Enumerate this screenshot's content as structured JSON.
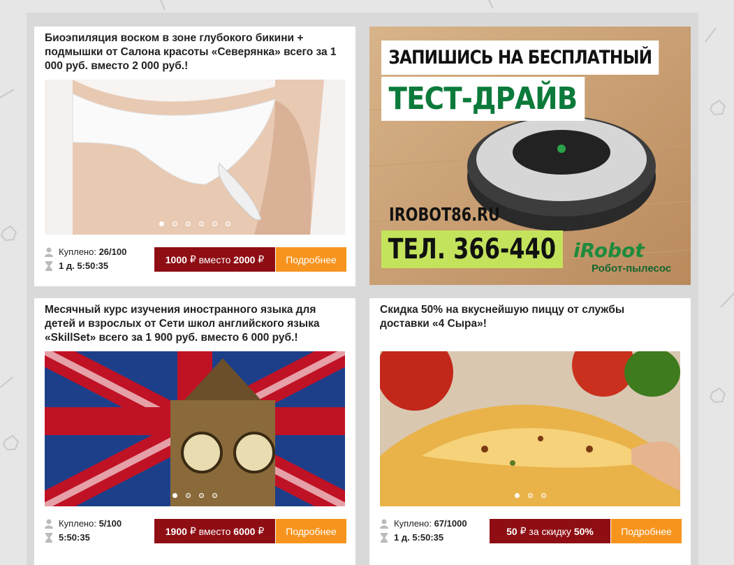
{
  "cards": [
    {
      "title": "Биоэпиляция воском в зоне глубокого бикини + подмышки от Салона красоты «Северянка» всего за 1 000 руб. вместо 2 000 руб.!",
      "bought_label": "Куплено:",
      "bought_value": "26/100",
      "timer": "1 д. 5:50:35",
      "price_new": "1000",
      "price_mid": "вместо",
      "price_old": "2000",
      "currency": "₽",
      "more_label": "Подробнее",
      "slides": 6,
      "active_slide": 1
    },
    {
      "title": "Месячный курс изучения иностранного языка для детей и взрослых от Сети школ английского языка «SkillSet» всего за 1 900 руб. вместо 6 000 руб.!",
      "bought_label": "Куплено:",
      "bought_value": "5/100",
      "timer": "5:50:35",
      "price_new": "1900",
      "price_mid": "вместо",
      "price_old": "6000",
      "currency": "₽",
      "more_label": "Подробнее",
      "slides": 4,
      "active_slide": 1
    },
    {
      "title": "Скидка 50% на вкуснейшую пиццу от службы доставки «4 Сыра»!",
      "bought_label": "Куплено:",
      "bought_value": "67/1000",
      "timer": "1 д. 5:50:35",
      "price_new": "50",
      "price_mid": "за скидку",
      "price_old": "50%",
      "currency": "₽",
      "more_label": "Подробнее",
      "slides": 3,
      "active_slide": 1
    }
  ],
  "ad": {
    "line1": "ЗАПИШИСЬ НА БЕСПЛАТНЫЙ",
    "line2": "ТЕСТ-ДРАЙВ",
    "url": "IROBOT86.RU",
    "phone": "ТЕЛ. 366-440",
    "brand": "iRobot",
    "subtitle": "Робот-пылесос"
  },
  "icons": {
    "person": "person-icon",
    "hourglass": "hourglass-icon"
  },
  "colors": {
    "price_bg": "#8e0e14",
    "more_bg": "#f7941e",
    "ad_green": "#0b7a3a",
    "ad_phone_bg": "#c4e35c"
  }
}
